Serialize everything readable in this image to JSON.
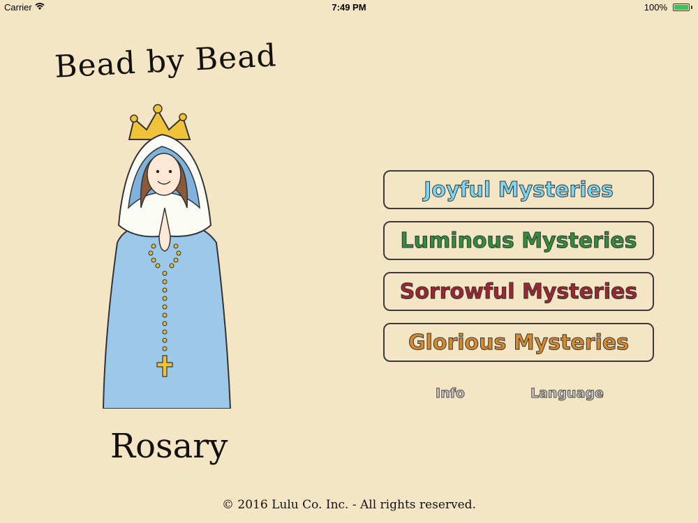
{
  "status_bar": {
    "carrier": "Carrier",
    "time": "7:49 PM",
    "battery": "100%"
  },
  "app_title": "Bead by Bead",
  "subtitle": "Rosary",
  "mysteries": [
    {
      "label": "Joyful Mysteries",
      "color": "#7cd6f3"
    },
    {
      "label": "Luminous Mysteries",
      "color": "#2f8f3a"
    },
    {
      "label": "Sorrowful Mysteries",
      "color": "#9e2630"
    },
    {
      "label": "Glorious Mysteries",
      "color": "#d68a2c"
    }
  ],
  "links": {
    "info": "Info",
    "language": "Language"
  },
  "footer": "© 2016 Lulu Co. Inc. - All rights reserved.",
  "icons": [
    "wifi-icon",
    "battery-icon",
    "mary-illustration"
  ]
}
